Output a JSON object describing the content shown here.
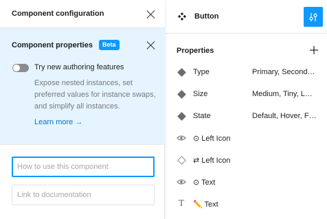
{
  "dialog": {
    "title": "Component configuration",
    "beta_section": {
      "title": "Component properties",
      "badge": "Beta",
      "toggle_label": "Try new authoring features",
      "toggle_on": false,
      "description": "Expose nested instances, set preferred values for instance swaps, and simplify all instances.",
      "learn_more": "Learn more →"
    },
    "usage_field": {
      "placeholder": "How to use this component",
      "value": ""
    },
    "doc_field": {
      "placeholder": "Link to documentation",
      "value": ""
    }
  },
  "right_panel": {
    "component_name": "Button",
    "properties_heading": "Properties",
    "properties": [
      {
        "icon": "variant-diamond-icon",
        "name": "Type",
        "value": "Primary, Second…"
      },
      {
        "icon": "variant-diamond-icon",
        "name": "Size",
        "value": "Medium, Tiny, L…"
      },
      {
        "icon": "variant-diamond-icon",
        "name": "State",
        "value": "Default, Hover, F…"
      },
      {
        "icon": "eye-icon",
        "name": "⊙ Left Icon",
        "value": ""
      },
      {
        "icon": "instance-swap-icon",
        "name": "⇄ Left Icon",
        "value": ""
      },
      {
        "icon": "eye-icon",
        "name": "⊙ Text",
        "value": ""
      },
      {
        "icon": "text-icon",
        "name": "✏️ Text",
        "value": ""
      }
    ]
  },
  "colors": {
    "accent": "#0d99ff",
    "beta_background": "#e5f4ff",
    "link": "#0d73c9"
  }
}
